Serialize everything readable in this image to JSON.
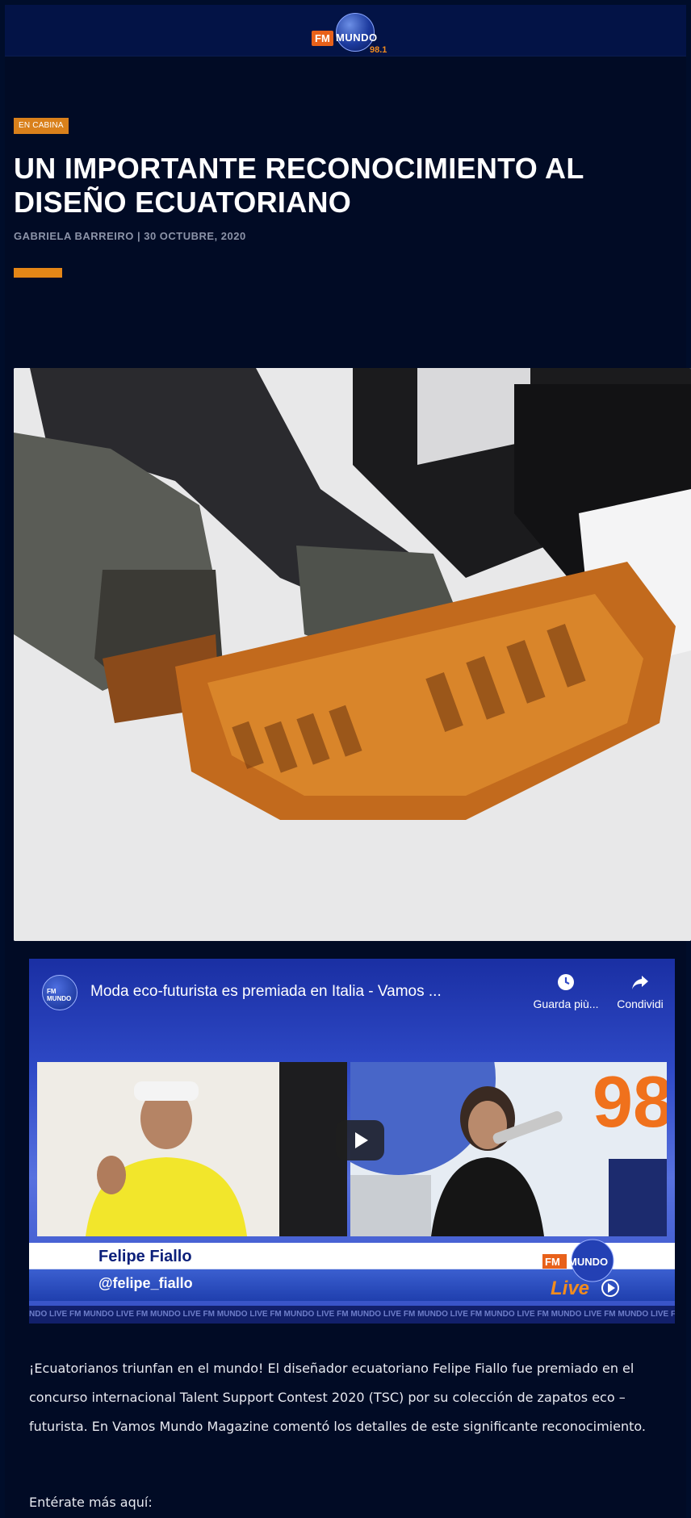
{
  "header": {
    "logo": {
      "fm": "FM",
      "mundo": "MUNDO",
      "frequency": "98.1"
    }
  },
  "article": {
    "category": "EN CABINA",
    "title": "UN IMPORTANTE RECONOCIMIENTO AL DISEÑO ECUATORIANO",
    "byline": "GABRIELA BARREIRO | 30 OCTUBRE, 2020",
    "body": "¡Ecuatorianos triunfan en el mundo! El diseñador ecuatoriano Felipe Fiallo fue premiado en el concurso internacional Talent Support Contest 2020 (TSC) por su colección de zapatos eco – futurista. En Vamos Mundo Magazine comentó los detalles de este significante reconocimiento.",
    "more_label": "Entérate más aquí:"
  },
  "video": {
    "channel_icon_text": "FM MUNDO",
    "title": "Moda eco-futurista es premiada en Italia - Vamos ...",
    "watch_later_label": "Guarda più...",
    "share_label": "Condividi",
    "guest_name": "Felipe Fiallo",
    "guest_handle": "@felipe_fiallo",
    "overlay_logo": {
      "fm": "FM",
      "mundo": "MUNDO",
      "live": "Live"
    },
    "ticker": "NDO LIVE  FM MUNDO LIVE  FM MUNDO LIVE  FM MUNDO LIVE  FM MUNDO LIVE  FM MUNDO LIVE  FM MUNDO LIVE  FM MUNDO LIVE  FM MUNDO LIVE  FM MUNDO LIVE  FM"
  },
  "colors": {
    "background": "#010b25",
    "header": "#031346",
    "accent": "#e48617",
    "category_bg": "#d9801b"
  }
}
